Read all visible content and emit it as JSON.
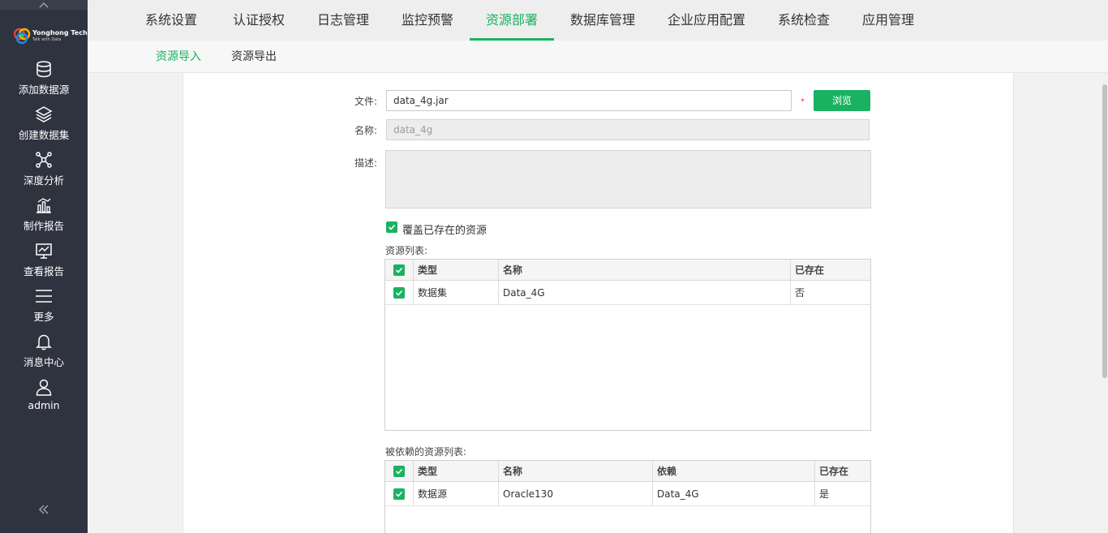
{
  "sidebar": {
    "brand": {
      "name": "Yonghong Tech",
      "tagline": "Talk with Data"
    },
    "items": [
      {
        "label": "添加数据源",
        "icon": "database-icon"
      },
      {
        "label": "创建数据集",
        "icon": "layers-icon"
      },
      {
        "label": "深度分析",
        "icon": "network-icon"
      },
      {
        "label": "制作报告",
        "icon": "bar-chart-icon"
      },
      {
        "label": "查看报告",
        "icon": "monitor-chart-icon"
      },
      {
        "label": "更多",
        "icon": "menu-icon"
      },
      {
        "label": "消息中心",
        "icon": "bell-icon"
      },
      {
        "label": "admin",
        "icon": "user-icon"
      }
    ],
    "collapse_icon": "double-chevron-left-icon"
  },
  "top_tabs": [
    {
      "label": "系统设置",
      "active": false
    },
    {
      "label": "认证授权",
      "active": false
    },
    {
      "label": "日志管理",
      "active": false
    },
    {
      "label": "监控预警",
      "active": false
    },
    {
      "label": "资源部署",
      "active": true
    },
    {
      "label": "数据库管理",
      "active": false
    },
    {
      "label": "企业应用配置",
      "active": false
    },
    {
      "label": "系统检查",
      "active": false
    },
    {
      "label": "应用管理",
      "active": false
    }
  ],
  "sub_tabs": [
    {
      "label": "资源导入",
      "active": true
    },
    {
      "label": "资源导出",
      "active": false
    }
  ],
  "form": {
    "file_label": "文件:",
    "file_value": "data_4g.jar",
    "required_mark": "*",
    "browse_label": "浏览",
    "name_label": "名称:",
    "name_value": "data_4g",
    "desc_label": "描述:",
    "desc_value": "",
    "overwrite_label": "覆盖已存在的资源",
    "overwrite_checked": true
  },
  "resource_list": {
    "title": "资源列表:",
    "columns": [
      "类型",
      "名称",
      "已存在"
    ],
    "rows": [
      {
        "checked": true,
        "type": "数据集",
        "name": "Data_4G",
        "exists": "否"
      }
    ]
  },
  "dependency_list": {
    "title": "被依赖的资源列表:",
    "columns": [
      "类型",
      "名称",
      "依赖",
      "已存在"
    ],
    "rows": [
      {
        "checked": true,
        "type": "数据源",
        "name": "Oracle130",
        "depends": "Data_4G",
        "exists": "是"
      }
    ]
  },
  "colors": {
    "accent": "#1ab261",
    "sidebar_bg": "#2f3340",
    "required": "#e03a3a"
  }
}
